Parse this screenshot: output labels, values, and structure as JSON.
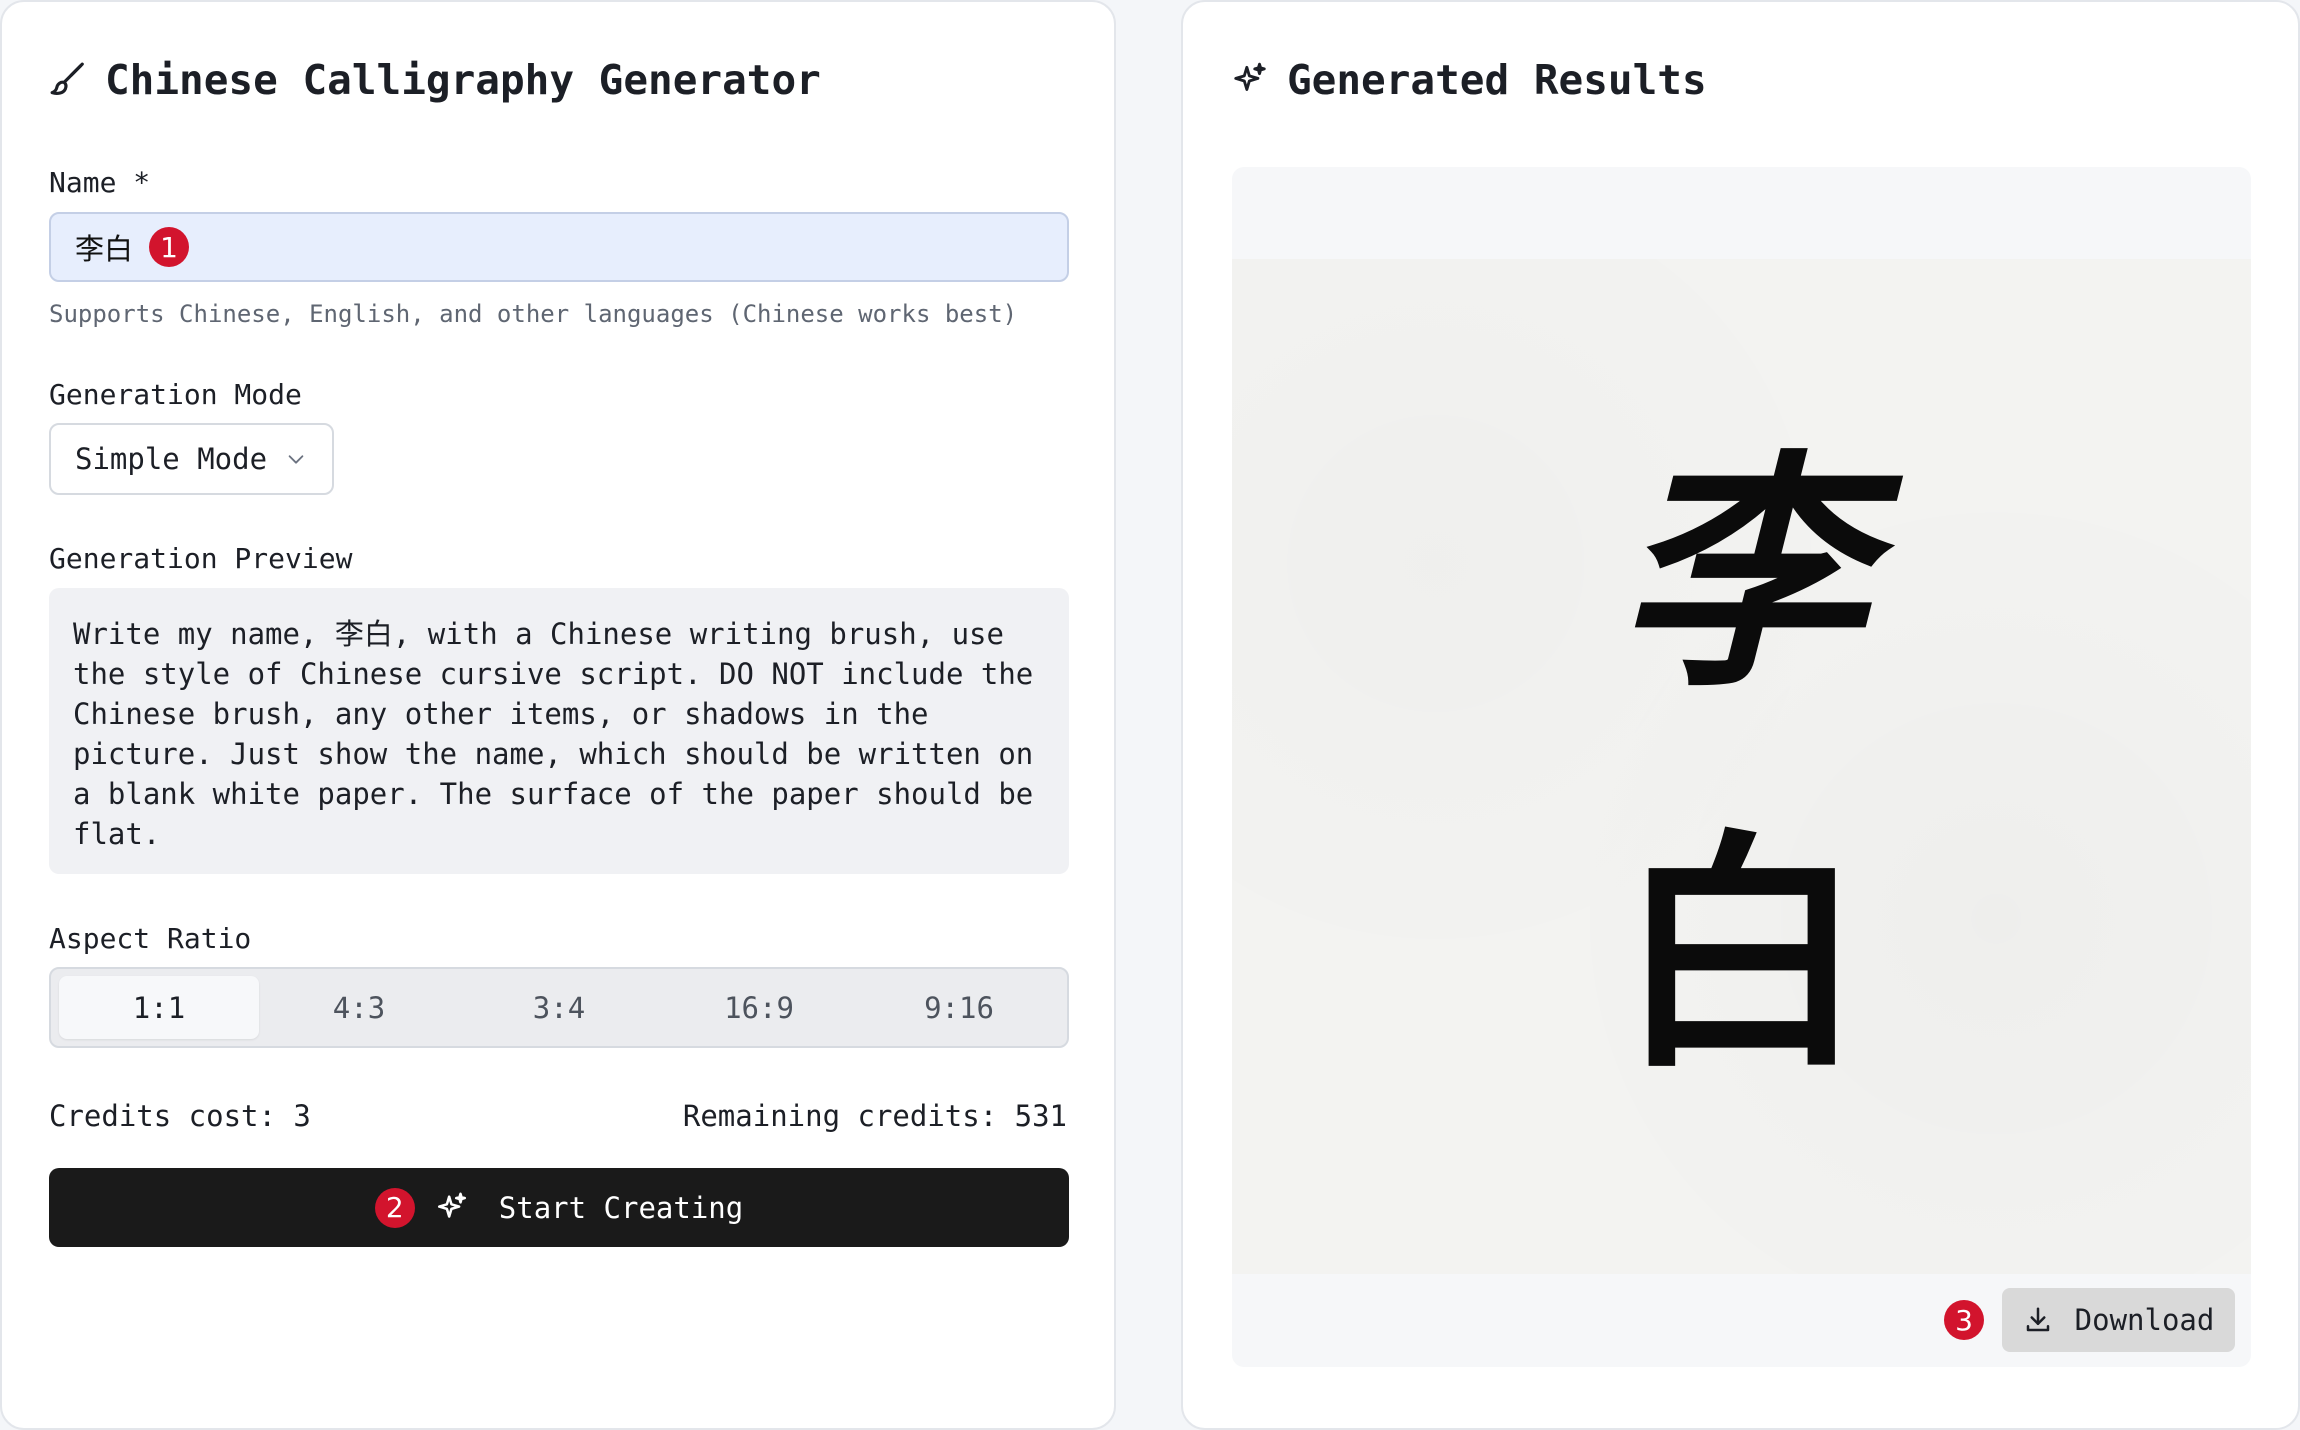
{
  "left_panel": {
    "title": "Chinese Calligraphy Generator",
    "icon": "brush-icon",
    "name_field": {
      "label": "Name *",
      "value": "李白",
      "hint": "Supports Chinese, English, and other languages (Chinese works best)"
    },
    "generation_mode": {
      "label": "Generation Mode",
      "selected": "Simple Mode"
    },
    "generation_preview": {
      "label": "Generation Preview",
      "text": "Write my name, 李白, with a Chinese writing brush, use the style of Chinese cursive script. DO NOT include the Chinese brush, any other items, or shadows in the picture. Just show the name, which should be written on a blank white paper. The surface of the paper should be flat."
    },
    "aspect_ratio": {
      "label": "Aspect Ratio",
      "options": [
        "1:1",
        "4:3",
        "3:4",
        "16:9",
        "9:16"
      ],
      "selected": "1:1"
    },
    "credits_cost": "Credits cost: 3",
    "remaining_credits": "Remaining credits: 531",
    "start_button": "Start Creating"
  },
  "right_panel": {
    "title": "Generated Results",
    "icon": "sparkles-icon",
    "result_characters": [
      "李",
      "白"
    ],
    "download_button": "Download"
  },
  "annotations": {
    "badge_1": "1",
    "badge_2": "2",
    "badge_3": "3"
  },
  "colors": {
    "badge": "#d2142d",
    "primary_button": "#1a1a1a",
    "input_bg": "#e7eefd"
  }
}
